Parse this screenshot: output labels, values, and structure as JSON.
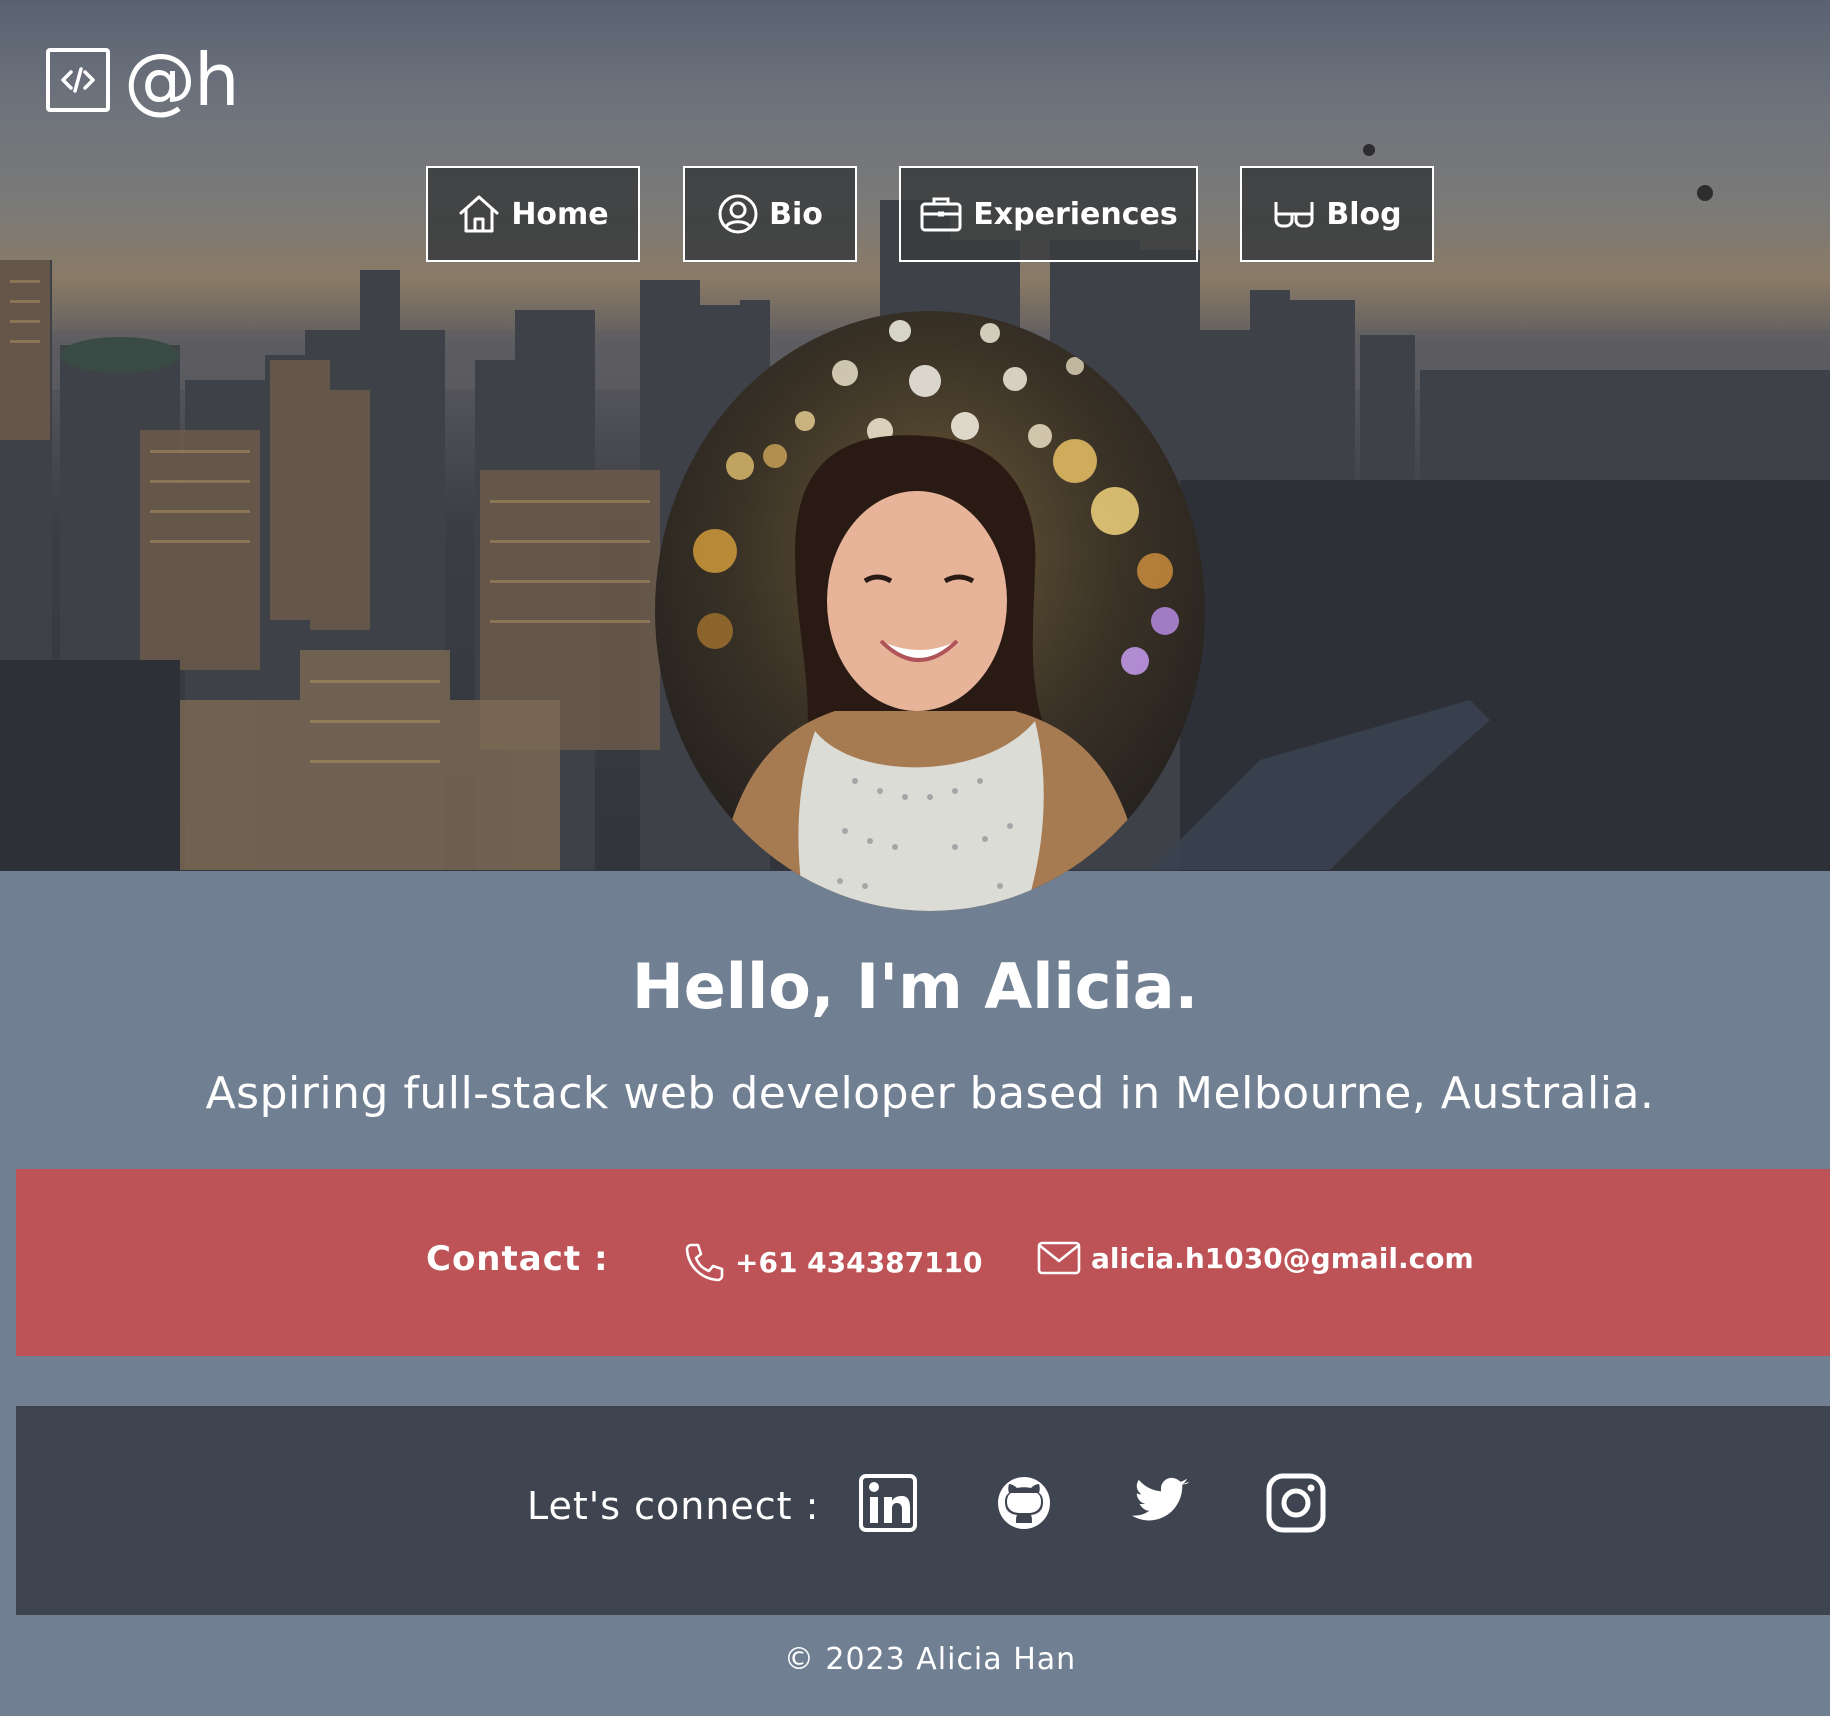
{
  "logo": {
    "text": "@h",
    "icon": "code-square-icon"
  },
  "nav": [
    {
      "label": "Home",
      "icon": "home-icon"
    },
    {
      "label": "Bio",
      "icon": "user-circle-icon"
    },
    {
      "label": "Experiences",
      "icon": "briefcase-icon"
    },
    {
      "label": "Blog",
      "icon": "glasses-icon"
    }
  ],
  "hero": {
    "greeting": "Hello, I'm Alicia.",
    "tagline": "Aspiring full-stack web developer based in Melbourne, Australia."
  },
  "contact": {
    "label": "Contact :",
    "phone": "+61 434387110",
    "email": "alicia.h1030@gmail.com"
  },
  "social": {
    "label": "Let's connect :",
    "links": [
      {
        "icon": "linkedin-icon"
      },
      {
        "icon": "github-icon"
      },
      {
        "icon": "twitter-icon"
      },
      {
        "icon": "instagram-icon"
      }
    ]
  },
  "footer": {
    "copyright": "© 2023 Alicia Han"
  },
  "colors": {
    "page_bg": "#717f93",
    "contact_bg": "#bd5356",
    "social_bg": "#3f4550",
    "nav_bg": "#3a3c3e",
    "text": "#ffffff"
  }
}
